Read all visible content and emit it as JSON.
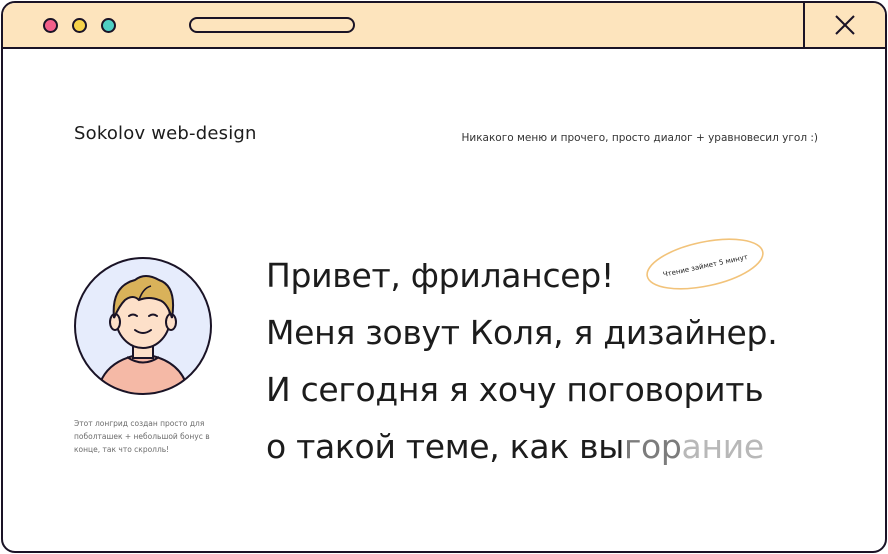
{
  "window": {
    "title_dots": [
      "close-dot",
      "minimize-dot",
      "maximize-dot"
    ],
    "colors": {
      "titlebar": "#fde4bd",
      "outline": "#1a1326",
      "dot_red": "#f2608a",
      "dot_yellow": "#f6d24a",
      "dot_green": "#4fcfc3"
    }
  },
  "header": {
    "brand": "Sokolov web-design",
    "tagline": "Никакого меню и прочего, просто диалог + уравновесил угол :)"
  },
  "hero": {
    "line1": "Привет, фрилансер!",
    "line2": "Меня зовут Коля, я дизайнер.",
    "line3": "И сегодня я хочу поговорить",
    "line4_main": "о такой теме, как вы",
    "line4_fade1": "гор",
    "line4_fade2": "ание",
    "badge": "Чтение займет 5 минут",
    "badge_color": "#f2c37a"
  },
  "side": {
    "caption": "Этот лонгрид создан просто для поболташек + небольшой бонус в конце, так что скролль!",
    "avatar_icon": "avatar-illustration"
  }
}
